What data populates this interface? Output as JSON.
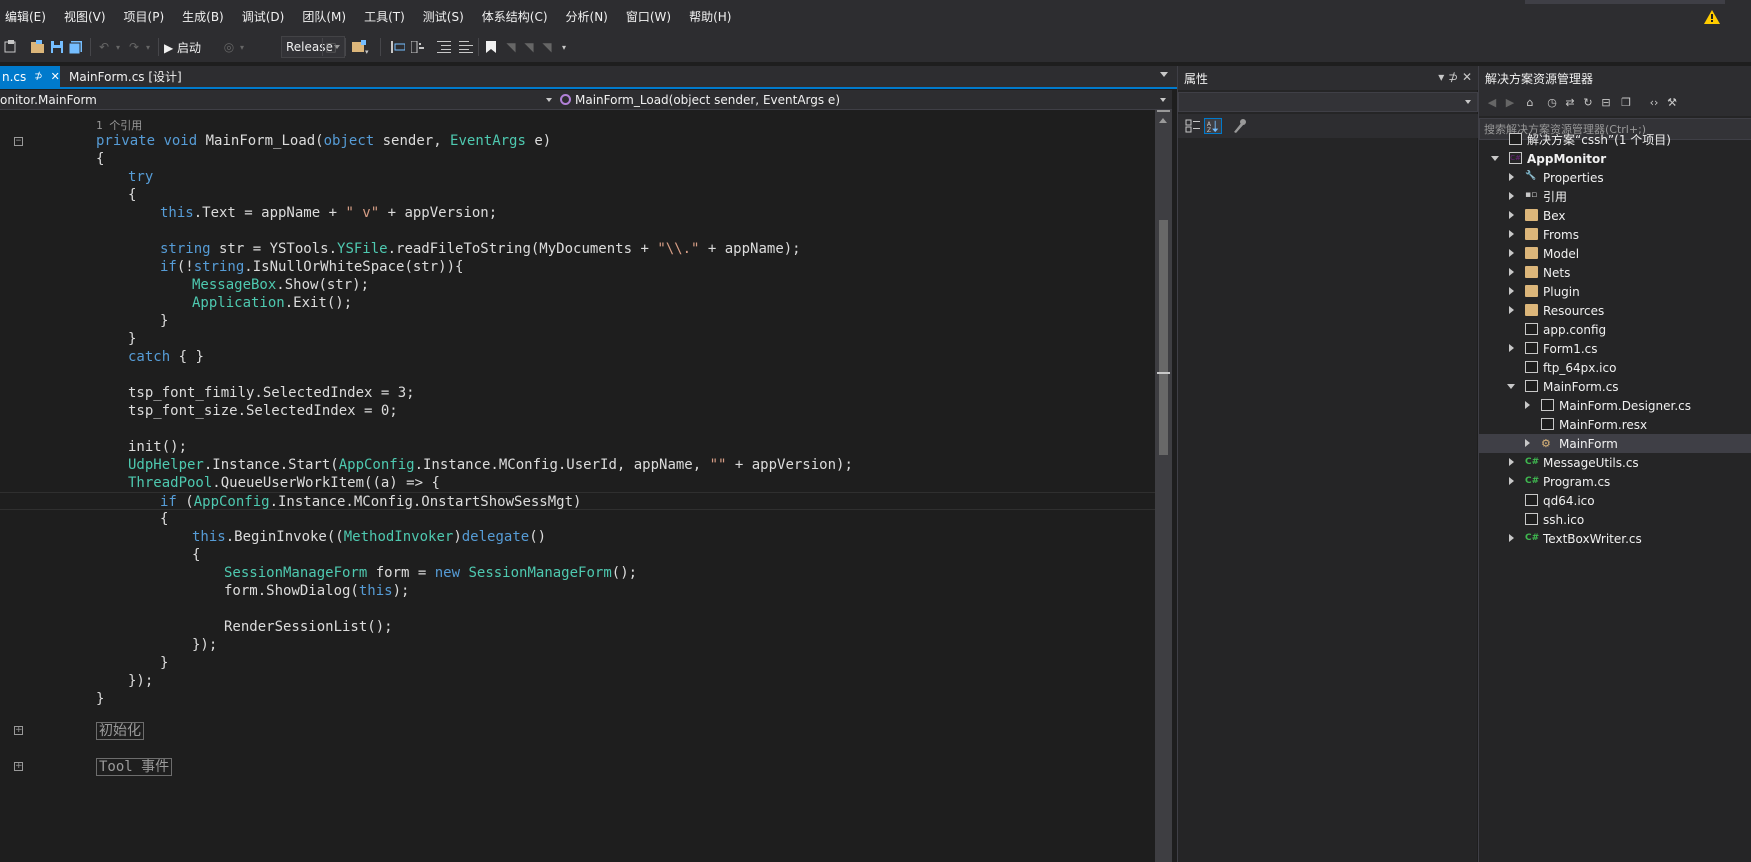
{
  "menu": [
    "编辑(E)",
    "视图(V)",
    "项目(P)",
    "生成(B)",
    "调试(D)",
    "团队(M)",
    "工具(T)",
    "测试(S)",
    "体系结构(C)",
    "分析(N)",
    "窗口(W)",
    "帮助(H)"
  ],
  "toolbar": {
    "start_label": "▶ 启动",
    "config": "Release"
  },
  "tabs": {
    "active": "n.cs",
    "active_pin": "⊅",
    "active_close": "✕",
    "inactive": "MainForm.cs [设计]"
  },
  "navbar": {
    "type": "onitor.MainForm",
    "member": "MainForm_Load(object sender, EventArgs e)"
  },
  "editor": {
    "codelens": "1 个引用",
    "lines": [
      {
        "indent": 0,
        "parts": [
          [
            "k",
            "private"
          ],
          [
            "",
            " "
          ],
          [
            "k",
            "void"
          ],
          [
            "",
            " MainForm_Load("
          ],
          [
            "k",
            "object"
          ],
          [
            "",
            " sender, "
          ],
          [
            "t",
            "EventArgs"
          ],
          [
            "",
            " e)"
          ]
        ]
      },
      {
        "indent": 0,
        "parts": [
          [
            "",
            "{"
          ]
        ]
      },
      {
        "indent": 1,
        "parts": [
          [
            "k",
            "try"
          ]
        ]
      },
      {
        "indent": 1,
        "parts": [
          [
            "",
            "{"
          ]
        ]
      },
      {
        "indent": 2,
        "parts": [
          [
            "k",
            "this"
          ],
          [
            "",
            ".Text = appName + "
          ],
          [
            "s",
            "\" v\""
          ],
          [
            "",
            " + appVersion;"
          ]
        ]
      },
      {
        "indent": 2,
        "parts": []
      },
      {
        "indent": 2,
        "parts": [
          [
            "k",
            "string"
          ],
          [
            "",
            " str = YSTools."
          ],
          [
            "t",
            "YSFile"
          ],
          [
            "",
            ".readFileToString(MyDocuments + "
          ],
          [
            "s",
            "\"\\\\.\""
          ],
          [
            "",
            " + appName);"
          ]
        ]
      },
      {
        "indent": 2,
        "parts": [
          [
            "k",
            "if"
          ],
          [
            "",
            "(!"
          ],
          [
            "k",
            "string"
          ],
          [
            "",
            ".IsNullOrWhiteSpace(str)){"
          ]
        ]
      },
      {
        "indent": 3,
        "parts": [
          [
            "t",
            "MessageBox"
          ],
          [
            "",
            ".Show(str);"
          ]
        ]
      },
      {
        "indent": 3,
        "parts": [
          [
            "t",
            "Application"
          ],
          [
            "",
            ".Exit();"
          ]
        ]
      },
      {
        "indent": 2,
        "parts": [
          [
            "",
            "}"
          ]
        ]
      },
      {
        "indent": 1,
        "parts": [
          [
            "",
            "}"
          ]
        ]
      },
      {
        "indent": 1,
        "parts": [
          [
            "k",
            "catch"
          ],
          [
            "",
            " { }"
          ]
        ]
      },
      {
        "indent": 1,
        "parts": []
      },
      {
        "indent": 1,
        "parts": [
          [
            "",
            "tsp_font_fimily.SelectedIndex = 3;"
          ]
        ]
      },
      {
        "indent": 1,
        "parts": [
          [
            "",
            "tsp_font_size.SelectedIndex = 0;"
          ]
        ]
      },
      {
        "indent": 1,
        "parts": []
      },
      {
        "indent": 1,
        "parts": [
          [
            "",
            "init();"
          ]
        ]
      },
      {
        "indent": 1,
        "parts": [
          [
            "t",
            "UdpHelper"
          ],
          [
            "",
            ".Instance.Start("
          ],
          [
            "t",
            "AppConfig"
          ],
          [
            "",
            ".Instance.MConfig.UserId, appName, "
          ],
          [
            "s",
            "\"\""
          ],
          [
            "",
            " + appVersion);"
          ]
        ]
      },
      {
        "indent": 1,
        "parts": [
          [
            "t",
            "ThreadPool"
          ],
          [
            "",
            ".QueueUserWorkItem((a) => {"
          ]
        ]
      },
      {
        "indent": 2,
        "parts": [
          [
            "k",
            "if"
          ],
          [
            "",
            " ("
          ],
          [
            "t",
            "AppConfig"
          ],
          [
            "",
            ".Instance.MConfig.OnstartShowSessMgt)"
          ]
        ],
        "current": true
      },
      {
        "indent": 2,
        "parts": [
          [
            "",
            "{"
          ]
        ]
      },
      {
        "indent": 3,
        "parts": [
          [
            "k",
            "this"
          ],
          [
            "",
            ".BeginInvoke(("
          ],
          [
            "t",
            "MethodInvoker"
          ],
          [
            "",
            ")"
          ],
          [
            "k",
            "delegate"
          ],
          [
            "",
            "()"
          ]
        ]
      },
      {
        "indent": 3,
        "parts": [
          [
            "",
            "{"
          ]
        ]
      },
      {
        "indent": 4,
        "parts": [
          [
            "t",
            "SessionManageForm"
          ],
          [
            "",
            " form = "
          ],
          [
            "k",
            "new"
          ],
          [
            "",
            " "
          ],
          [
            "t",
            "SessionManageForm"
          ],
          [
            "",
            "();"
          ]
        ]
      },
      {
        "indent": 4,
        "parts": [
          [
            "",
            "form.ShowDialog("
          ],
          [
            "k",
            "this"
          ],
          [
            "",
            ");"
          ]
        ]
      },
      {
        "indent": 4,
        "parts": []
      },
      {
        "indent": 4,
        "parts": [
          [
            "",
            "RenderSessionList();"
          ]
        ]
      },
      {
        "indent": 3,
        "parts": [
          [
            "",
            "});"
          ]
        ]
      },
      {
        "indent": 2,
        "parts": [
          [
            "",
            "}"
          ]
        ]
      },
      {
        "indent": 1,
        "parts": [
          [
            "",
            "});"
          ]
        ]
      },
      {
        "indent": 0,
        "parts": [
          [
            "",
            "}"
          ]
        ]
      }
    ],
    "regions": [
      "初始化",
      "Tool 事件"
    ]
  },
  "properties": {
    "title": "属性",
    "pin": "▾  ⊅  ✕"
  },
  "solution_explorer": {
    "title": "解决方案资源管理器",
    "search_placeholder": "搜索解决方案资源管理器(Ctrl+;)",
    "items": [
      {
        "label": "解决方案“cssh”(1 个项目)",
        "level": 0,
        "exp": "none",
        "icon": "solution"
      },
      {
        "label": "AppMonitor",
        "level": 0,
        "exp": "open",
        "icon": "csproj",
        "bold": true
      },
      {
        "label": "Properties",
        "level": 1,
        "exp": "closed",
        "icon": "wrench"
      },
      {
        "label": "引用",
        "level": 1,
        "exp": "closed",
        "icon": "refs"
      },
      {
        "label": "Bex",
        "level": 1,
        "exp": "closed",
        "icon": "folder"
      },
      {
        "label": "Froms",
        "level": 1,
        "exp": "closed",
        "icon": "folder"
      },
      {
        "label": "Model",
        "level": 1,
        "exp": "closed",
        "icon": "folder"
      },
      {
        "label": "Nets",
        "level": 1,
        "exp": "closed",
        "icon": "folder"
      },
      {
        "label": "Plugin",
        "level": 1,
        "exp": "closed",
        "icon": "folder"
      },
      {
        "label": "Resources",
        "level": 1,
        "exp": "closed",
        "icon": "folder"
      },
      {
        "label": "app.config",
        "level": 1,
        "exp": "none",
        "icon": "config"
      },
      {
        "label": "Form1.cs",
        "level": 1,
        "exp": "closed",
        "icon": "form"
      },
      {
        "label": "ftp_64px.ico",
        "level": 1,
        "exp": "none",
        "icon": "file"
      },
      {
        "label": "MainForm.cs",
        "level": 1,
        "exp": "open",
        "icon": "form"
      },
      {
        "label": "MainForm.Designer.cs",
        "level": 2,
        "exp": "closed",
        "icon": "config"
      },
      {
        "label": "MainForm.resx",
        "level": 2,
        "exp": "none",
        "icon": "config"
      },
      {
        "label": "MainForm",
        "level": 2,
        "exp": "closed",
        "icon": "class",
        "selected": true
      },
      {
        "label": "MessageUtils.cs",
        "level": 1,
        "exp": "closed",
        "icon": "cs"
      },
      {
        "label": "Program.cs",
        "level": 1,
        "exp": "closed",
        "icon": "cs"
      },
      {
        "label": "qd64.ico",
        "level": 1,
        "exp": "none",
        "icon": "file"
      },
      {
        "label": "ssh.ico",
        "level": 1,
        "exp": "none",
        "icon": "file"
      },
      {
        "label": "TextBoxWriter.cs",
        "level": 1,
        "exp": "closed",
        "icon": "cs"
      }
    ]
  },
  "colors": {
    "accent": "#007acc",
    "keyword": "#569cd6",
    "type": "#4ec9b0",
    "string": "#d69d85"
  }
}
